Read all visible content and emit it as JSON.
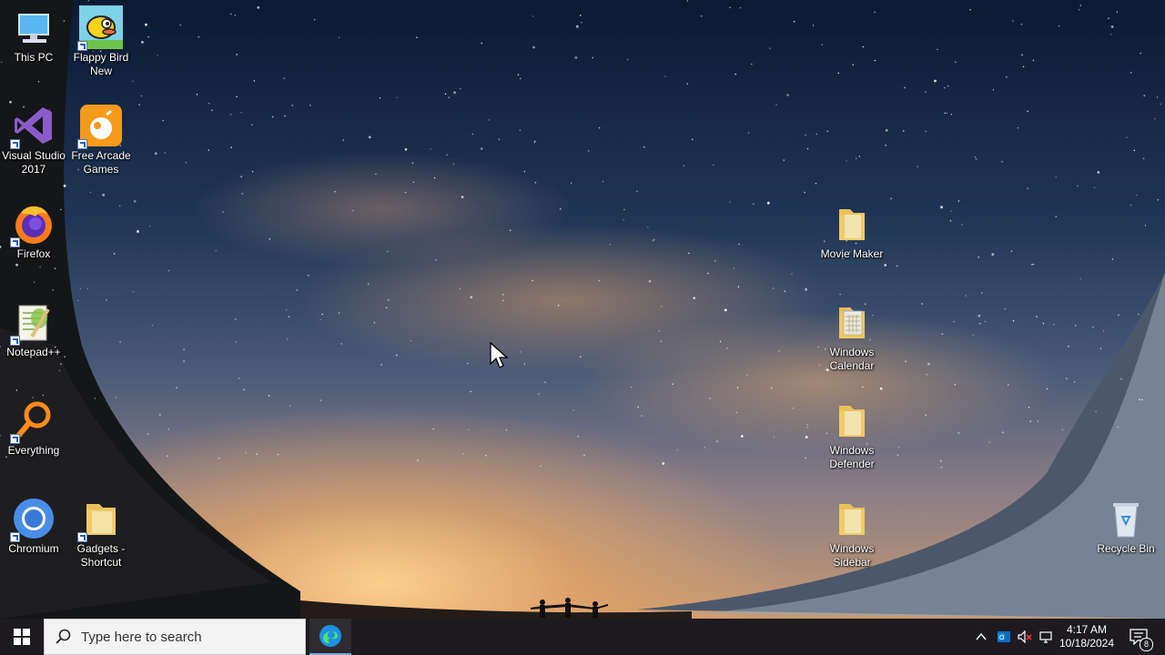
{
  "desktop": {
    "icons_left": [
      {
        "id": "this-pc",
        "label": "This PC"
      },
      {
        "id": "flappy-bird",
        "label": "Flappy Bird New"
      },
      {
        "id": "visual-studio",
        "label": "Visual Studio 2017"
      },
      {
        "id": "free-arcade",
        "label": "Free Arcade Games"
      },
      {
        "id": "firefox",
        "label": "Firefox"
      },
      {
        "id": "notepadpp",
        "label": "Notepad++"
      },
      {
        "id": "everything",
        "label": "Everything"
      },
      {
        "id": "chromium",
        "label": "Chromium"
      },
      {
        "id": "gadgets",
        "label": "Gadgets - Shortcut"
      }
    ],
    "icons_right": [
      {
        "id": "movie-maker",
        "label": "Movie Maker"
      },
      {
        "id": "windows-calendar",
        "label": "Windows Calendar"
      },
      {
        "id": "windows-defender",
        "label": "Windows Defender"
      },
      {
        "id": "windows-sidebar",
        "label": "Windows Sidebar"
      },
      {
        "id": "recycle-bin",
        "label": "Recycle Bin"
      }
    ]
  },
  "taskbar": {
    "search_placeholder": "Type here to search",
    "pinned_apps": [
      "edge-icon"
    ],
    "tray_icons": [
      "chevron-up-icon",
      "outlook-icon",
      "volume-muted-icon",
      "network-icon"
    ],
    "clock": {
      "time": "4:17 AM",
      "date": "10/18/2024"
    },
    "notification_count": "8"
  },
  "colors": {
    "taskbar": "#1d1b1f",
    "search_bg": "#f3f3f3",
    "accent": "#0078d7"
  }
}
